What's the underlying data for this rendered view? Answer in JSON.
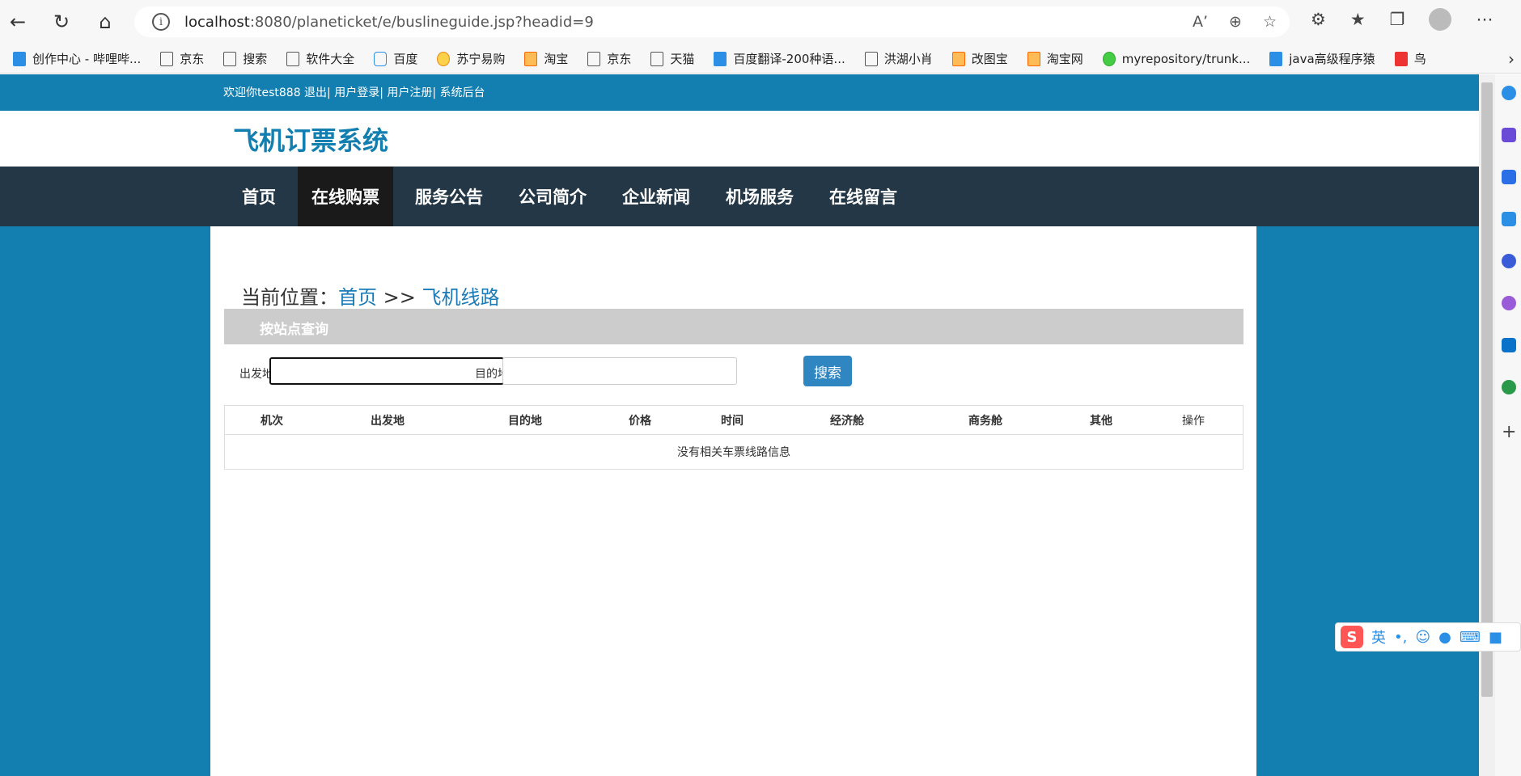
{
  "browser": {
    "url_host": "localhost",
    "url_rest": ":8080/planeticket/e/buslineguide.jsp?headid=9",
    "bookmarks": [
      "创作中心 - 哔哩哔...",
      "京东",
      "搜索",
      "软件大全",
      "百度",
      "苏宁易购",
      "淘宝",
      "京东",
      "天猫",
      "百度翻译-200种语...",
      "洪湖小肖",
      "改图宝",
      "淘宝网",
      "myrepository/trunk...",
      "java高级程序猿",
      "鸟"
    ]
  },
  "topbar": {
    "links": "欢迎你test888 退出| 用户登录| 用户注册| 系统后台"
  },
  "site": {
    "title": "飞机订票系统"
  },
  "nav": [
    "首页",
    "在线购票",
    "服务公告",
    "公司简介",
    "企业新闻",
    "机场服务",
    "在线留言"
  ],
  "breadcrumb": {
    "prefix": "当前位置：",
    "home": "首页",
    "sep": " >> ",
    "current": "飞机线路"
  },
  "search": {
    "panel_title": "按站点查询",
    "from_label": "出发地",
    "from_value": "",
    "to_label": "目的地",
    "to_value": "",
    "button": "搜索"
  },
  "table": {
    "columns": [
      "机次",
      "出发地",
      "目的地",
      "价格",
      "时间",
      "经济舱",
      "商务舱",
      "其他",
      "操作"
    ],
    "empty_message": "没有相关车票线路信息"
  },
  "ime": {
    "lang": "英"
  }
}
